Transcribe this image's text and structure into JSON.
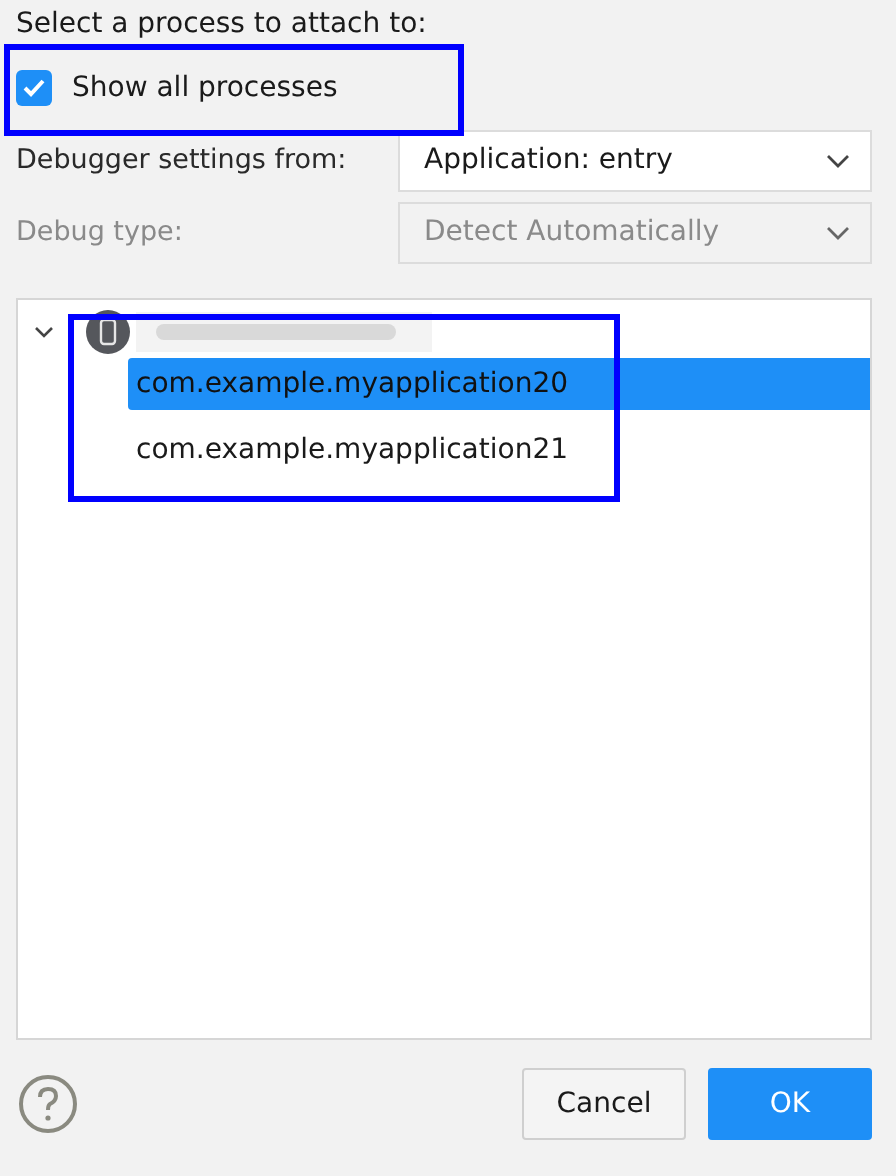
{
  "heading": "Select a process to attach to:",
  "show_all": {
    "label": "Show all processes",
    "checked": true
  },
  "settings": [
    {
      "label": "Debugger settings from:",
      "value": "Application: entry",
      "disabled": false
    },
    {
      "label": "Debug type:",
      "value": "Detect Automatically",
      "disabled": true
    }
  ],
  "tree": [
    {
      "expanded": true,
      "children": [
        {
          "label": "com.example.myapplication20",
          "selected": true
        },
        {
          "label": "com.example.myapplication21",
          "selected": false
        }
      ]
    }
  ],
  "buttons": [
    {
      "label": "Cancel",
      "kind": "secondary"
    },
    {
      "label": "OK",
      "kind": "primary"
    }
  ]
}
